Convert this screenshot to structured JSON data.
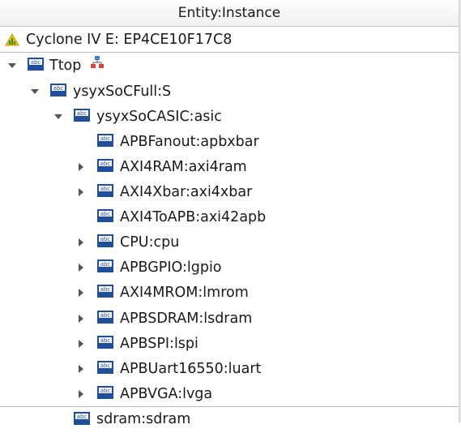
{
  "header": {
    "title": "Entity:Instance"
  },
  "tree": {
    "device": {
      "label": "Cyclone IV E: EP4CE10F17C8",
      "icon": "warning-triangle-icon"
    },
    "nodes": [
      {
        "label": "Ttop",
        "expanded": true,
        "icon": "entity-abc-icon",
        "extra_icon": "hierarchy-icon"
      },
      {
        "label": "ysyxSoCFull:S",
        "expanded": true,
        "icon": "entity-abc-icon"
      },
      {
        "label": "ysyxSoCASIC:asic",
        "expanded": true,
        "icon": "entity-abc-icon"
      },
      {
        "label": "APBFanout:apbxbar",
        "icon": "entity-abc-icon"
      },
      {
        "label": "AXI4RAM:axi4ram",
        "expanded": false,
        "icon": "entity-abc-icon"
      },
      {
        "label": "AXI4Xbar:axi4xbar",
        "expanded": false,
        "icon": "entity-abc-icon"
      },
      {
        "label": "AXI4ToAPB:axi42apb",
        "icon": "entity-abc-icon"
      },
      {
        "label": "CPU:cpu",
        "expanded": false,
        "icon": "entity-abc-icon"
      },
      {
        "label": "APBGPIO:lgpio",
        "expanded": false,
        "icon": "entity-abc-icon"
      },
      {
        "label": "AXI4MROM:lmrom",
        "expanded": false,
        "icon": "entity-abc-icon"
      },
      {
        "label": "APBSDRAM:lsdram",
        "expanded": false,
        "icon": "entity-abc-icon"
      },
      {
        "label": "APBSPI:lspi",
        "expanded": false,
        "icon": "entity-abc-icon"
      },
      {
        "label": "APBUart16550:luart",
        "expanded": false,
        "icon": "entity-abc-icon"
      },
      {
        "label": "APBVGA:lvga",
        "expanded": false,
        "icon": "entity-abc-icon"
      },
      {
        "label": "sdram:sdram",
        "icon": "entity-abc-icon"
      }
    ]
  },
  "colors": {
    "icon_blue": "#1f4e9a",
    "warn_yellow": "#f2c200",
    "hier_red": "#d04a3a"
  }
}
